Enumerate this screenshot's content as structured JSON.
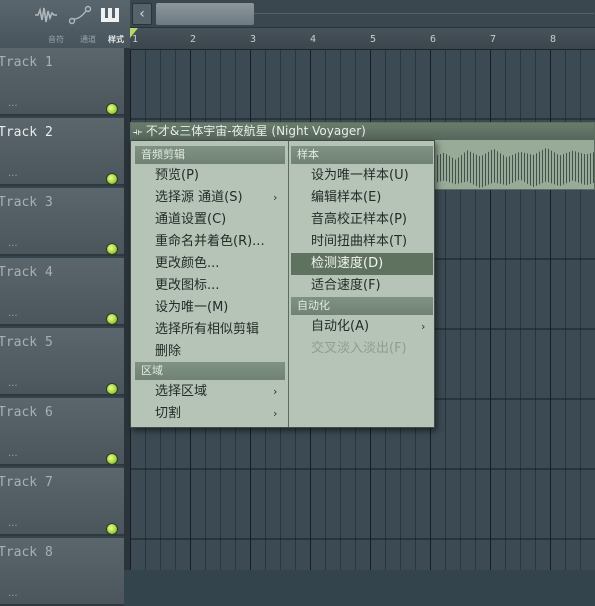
{
  "toolbar": {
    "items": [
      {
        "icon": "waveform-icon",
        "label": "音符"
      },
      {
        "icon": "automation-curve-icon",
        "label": "通道"
      },
      {
        "icon": "pattern-icon",
        "label": "样式"
      }
    ]
  },
  "ruler": {
    "bars": [
      "1",
      "2",
      "3",
      "4",
      "5",
      "6",
      "7",
      "8"
    ]
  },
  "tracks": [
    {
      "name": "Track 1",
      "dots": "..."
    },
    {
      "name": "Track 2",
      "dots": "..."
    },
    {
      "name": "Track 3",
      "dots": "..."
    },
    {
      "name": "Track 4",
      "dots": "..."
    },
    {
      "name": "Track 5",
      "dots": "..."
    },
    {
      "name": "Track 6",
      "dots": "..."
    },
    {
      "name": "Track 7",
      "dots": "..."
    },
    {
      "name": "Track 8",
      "dots": "..."
    }
  ],
  "clip": {
    "title": "不才&三体宇宙-夜航星 (Night Voyager)"
  },
  "context_menu": {
    "left": {
      "section1": "音频剪辑",
      "items1": [
        {
          "label": "预览(P)",
          "submenu": false
        },
        {
          "label": "选择源 通道(S)",
          "submenu": true
        },
        {
          "label": "通道设置(C)",
          "submenu": false
        },
        {
          "label": "重命名并着色(R)...",
          "submenu": false
        },
        {
          "label": "更改颜色...",
          "submenu": false
        },
        {
          "label": "更改图标...",
          "submenu": false
        },
        {
          "label": "设为唯一(M)",
          "submenu": false
        },
        {
          "label": "选择所有相似剪辑",
          "submenu": false
        },
        {
          "label": "删除",
          "submenu": false
        }
      ],
      "section2": "区域",
      "items2": [
        {
          "label": "选择区域",
          "submenu": true
        },
        {
          "label": "切割",
          "submenu": true
        }
      ]
    },
    "right": {
      "section1": "样本",
      "items1": [
        {
          "label": "设为唯一样本(U)",
          "highlight": false
        },
        {
          "label": "编辑样本(E)",
          "highlight": false
        },
        {
          "label": "音高校正样本(P)",
          "highlight": false
        },
        {
          "label": "时间扭曲样本(T)",
          "highlight": false
        },
        {
          "label": "检测速度(D)",
          "highlight": true
        },
        {
          "label": "适合速度(F)",
          "highlight": false
        }
      ],
      "section2": "自动化",
      "items2": [
        {
          "label": "自动化(A)",
          "submenu": true,
          "disabled": false
        },
        {
          "label": "交叉淡入淡出(F)",
          "submenu": false,
          "disabled": true
        }
      ]
    }
  },
  "colors": {
    "led_green": "#9ed23a",
    "clip_bg": "#97ab98",
    "menu_bg": "#b6c4b8",
    "menu_highlight": "#5f715f"
  }
}
